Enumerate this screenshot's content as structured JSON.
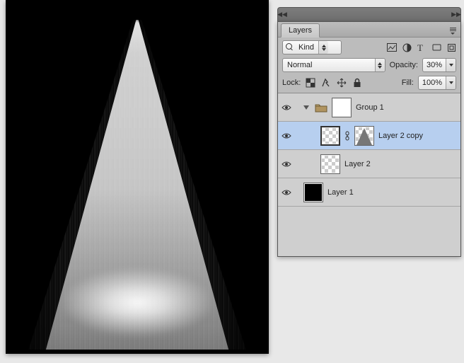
{
  "panel": {
    "title": "Layers",
    "filter": {
      "kind_label": "Kind"
    },
    "blend": {
      "mode": "Normal",
      "opacity_label": "Opacity:",
      "opacity_value": "30%"
    },
    "lock": {
      "label": "Lock:",
      "fill_label": "Fill:",
      "fill_value": "100%"
    },
    "layers": [
      {
        "name": "Group 1"
      },
      {
        "name": "Layer 2 copy"
      },
      {
        "name": "Layer 2"
      },
      {
        "name": "Layer 1"
      }
    ]
  }
}
